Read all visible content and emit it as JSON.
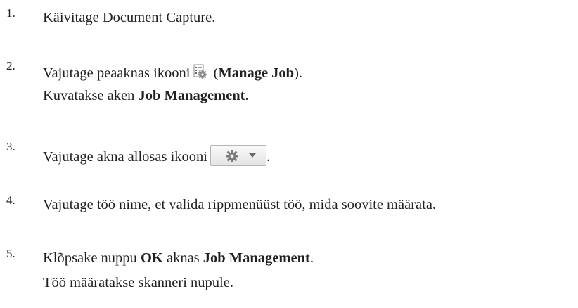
{
  "steps": [
    {
      "number": "1.",
      "text": "Käivitage Document Capture."
    },
    {
      "number": "2.",
      "pre": "Vajutage peaaknas ikooni",
      "paren_open": " (",
      "bold": "Manage Job",
      "paren_close": ").",
      "icon": "manage-job-icon",
      "result_pre": "Kuvatakse aken ",
      "result_bold": "Job Management",
      "result_post": "."
    },
    {
      "number": "3.",
      "pre": "Vajutage akna allosas ikooni",
      "post": ".",
      "icon": "gear-dropdown-icon"
    },
    {
      "number": "4.",
      "text": "Vajutage töö nime, et valida rippmenüüst töö, mida soovite määrata."
    },
    {
      "number": "5.",
      "pre": "Klõpsake nuppu ",
      "bold1": "OK",
      "mid": " aknas ",
      "bold2": "Job Management",
      "post": ".",
      "result": "Töö määratakse skanneri nupule."
    }
  ],
  "colors": {
    "text": "#231f20",
    "icon_border": "#b5b5b5",
    "gear": "#7a7a7a"
  }
}
